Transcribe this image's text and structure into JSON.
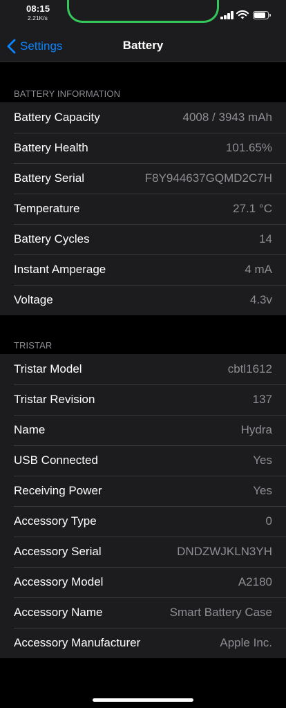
{
  "status_bar": {
    "time": "08:15",
    "network_speed": "2.21K/s",
    "signal_icon": "cellular-signal-icon",
    "wifi_icon": "wifi-icon",
    "battery_icon": "battery-icon",
    "indicator_color": "#34c759"
  },
  "nav": {
    "back_label": "Settings",
    "title": "Battery",
    "accent_color": "#0a84ff"
  },
  "battery_section": {
    "header": "BATTERY INFORMATION",
    "rows": [
      {
        "label": "Battery Capacity",
        "value": "4008 / 3943 mAh"
      },
      {
        "label": "Battery Health",
        "value": "101.65%"
      },
      {
        "label": "Battery Serial",
        "value": "F8Y944637GQMD2C7H"
      },
      {
        "label": "Temperature",
        "value": "27.1 °C"
      },
      {
        "label": "Battery Cycles",
        "value": "14"
      },
      {
        "label": "Instant Amperage",
        "value": "4 mA"
      },
      {
        "label": "Voltage",
        "value": "4.3v"
      }
    ]
  },
  "tristar_section": {
    "header": "TRISTAR",
    "rows": [
      {
        "label": "Tristar Model",
        "value": "cbtl1612"
      },
      {
        "label": "Tristar Revision",
        "value": "137"
      },
      {
        "label": "Name",
        "value": "Hydra"
      },
      {
        "label": "USB Connected",
        "value": "Yes"
      },
      {
        "label": "Receiving Power",
        "value": "Yes"
      },
      {
        "label": "Accessory Type",
        "value": "0"
      },
      {
        "label": "Accessory Serial",
        "value": "DNDZWJKLN3YH"
      },
      {
        "label": "Accessory Model",
        "value": "A2180"
      },
      {
        "label": "Accessory Name",
        "value": "Smart Battery Case"
      },
      {
        "label": "Accessory Manufacturer",
        "value": "Apple Inc."
      }
    ]
  }
}
